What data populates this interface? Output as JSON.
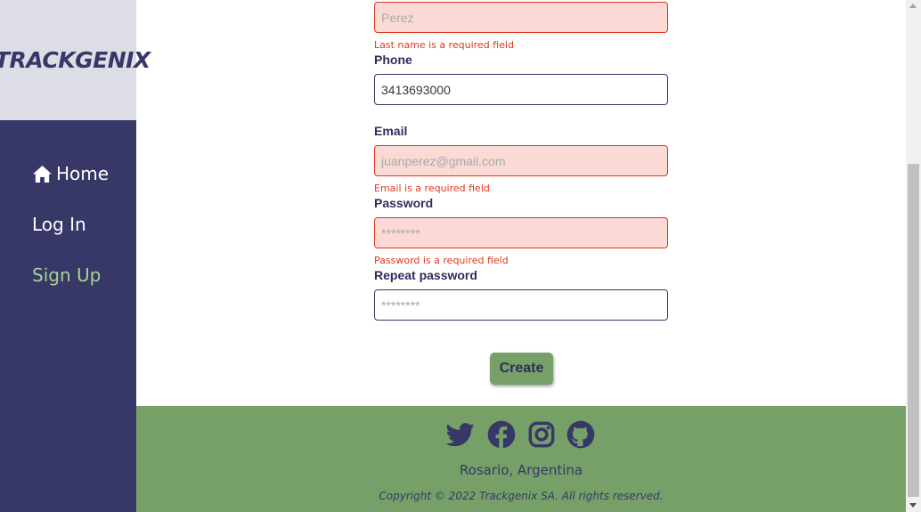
{
  "sidebar": {
    "logo": "TRACKGENIX",
    "nav": {
      "home": "Home",
      "login": "Log In",
      "signup": "Sign Up"
    }
  },
  "form": {
    "last_name": {
      "placeholder": "Perez",
      "error": "Last name is a required field"
    },
    "phone": {
      "label": "Phone",
      "value": "3413693000"
    },
    "email": {
      "label": "Email",
      "placeholder": "juanperez@gmail.com",
      "error": "Email is a required field"
    },
    "password": {
      "label": "Password",
      "placeholder": "********",
      "error": "Password is a required field"
    },
    "repeat_password": {
      "label": "Repeat password",
      "placeholder": "********"
    },
    "create_label": "Create"
  },
  "footer": {
    "social": [
      "twitter-icon",
      "facebook-icon",
      "instagram-icon",
      "github-icon"
    ],
    "location": "Rosario, Argentina",
    "copyright": "Copyright © 2022 Trackgenix SA. All rights reserved."
  },
  "colors": {
    "sidebar": "#373867",
    "logo_bg": "#dddde6",
    "accent_green": "#76a067",
    "nav_active": "#a7d294",
    "error": "#e0371f",
    "error_bg": "#fbd9d5"
  }
}
